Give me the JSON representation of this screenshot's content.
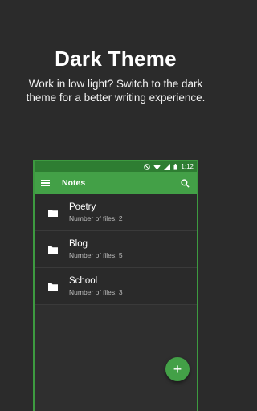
{
  "promo": {
    "title": "Dark Theme",
    "subtitle": "Work in low light? Switch to the dark theme for a better writing experience."
  },
  "statusbar": {
    "time": "1:12",
    "icons": [
      "do-not-disturb-icon",
      "wifi-icon",
      "signal-icon",
      "battery-icon"
    ]
  },
  "appbar": {
    "title": "Notes",
    "menu_icon": "menu-icon",
    "search_icon": "search-icon"
  },
  "folders": [
    {
      "name": "Poetry",
      "count": "Number of files: 2"
    },
    {
      "name": "Blog",
      "count": "Number of files: 5"
    },
    {
      "name": "School",
      "count": "Number of files: 3"
    }
  ],
  "fab": {
    "label": "+",
    "icon": "add-icon"
  },
  "colors": {
    "background": "#2b2b2b",
    "accent": "#43a047",
    "statusbar": "#2e7d32",
    "list_bg": "#2a2a2a"
  }
}
